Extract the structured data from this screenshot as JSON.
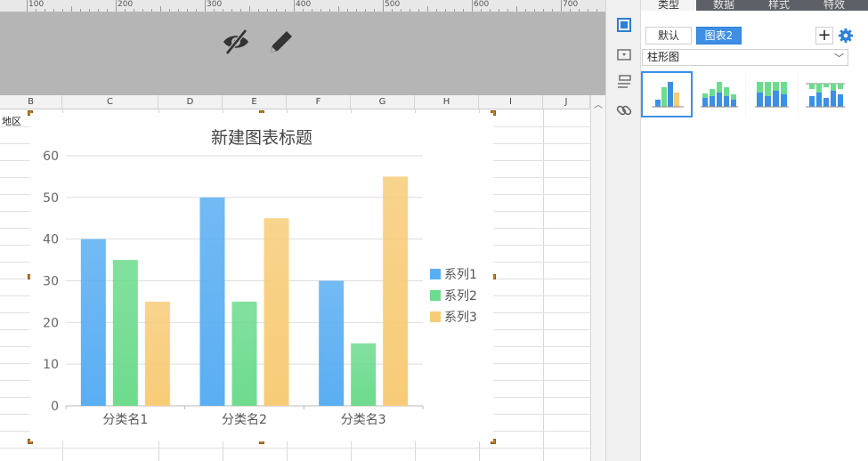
{
  "ruler": {
    "numbers": [
      "100",
      "200",
      "300",
      "400",
      "500",
      "600",
      "700"
    ]
  },
  "toolbar": {
    "hide_icon": "eye-slash-icon",
    "edit_icon": "pencil-icon"
  },
  "grid": {
    "columns": [
      "B",
      "C",
      "D",
      "E",
      "F",
      "G",
      "H",
      "I",
      "J"
    ],
    "cell_b1": "地区"
  },
  "chart_data": {
    "type": "bar",
    "title": "新建图表标题",
    "categories": [
      "分类名1",
      "分类名2",
      "分类名3"
    ],
    "series": [
      {
        "name": "系列1",
        "values": [
          40,
          50,
          30
        ],
        "color": "#5aaef2"
      },
      {
        "name": "系列2",
        "values": [
          35,
          25,
          15
        ],
        "color": "#6ddb8e"
      },
      {
        "name": "系列3",
        "values": [
          25,
          45,
          55
        ],
        "color": "#f7cc78"
      }
    ],
    "ylim": [
      0,
      60
    ],
    "yticks": [
      0,
      10,
      20,
      30,
      40,
      50,
      60
    ],
    "grid": true,
    "legend": "right"
  },
  "panel": {
    "tabs": [
      "类型",
      "数据",
      "样式",
      "特效"
    ],
    "active_tab": "类型",
    "buttons": {
      "default_label": "默认",
      "chart2_label": "图表2",
      "add_label": "+"
    },
    "chart_type_select": "柱形图",
    "accent_color": "#3d8fe6"
  }
}
